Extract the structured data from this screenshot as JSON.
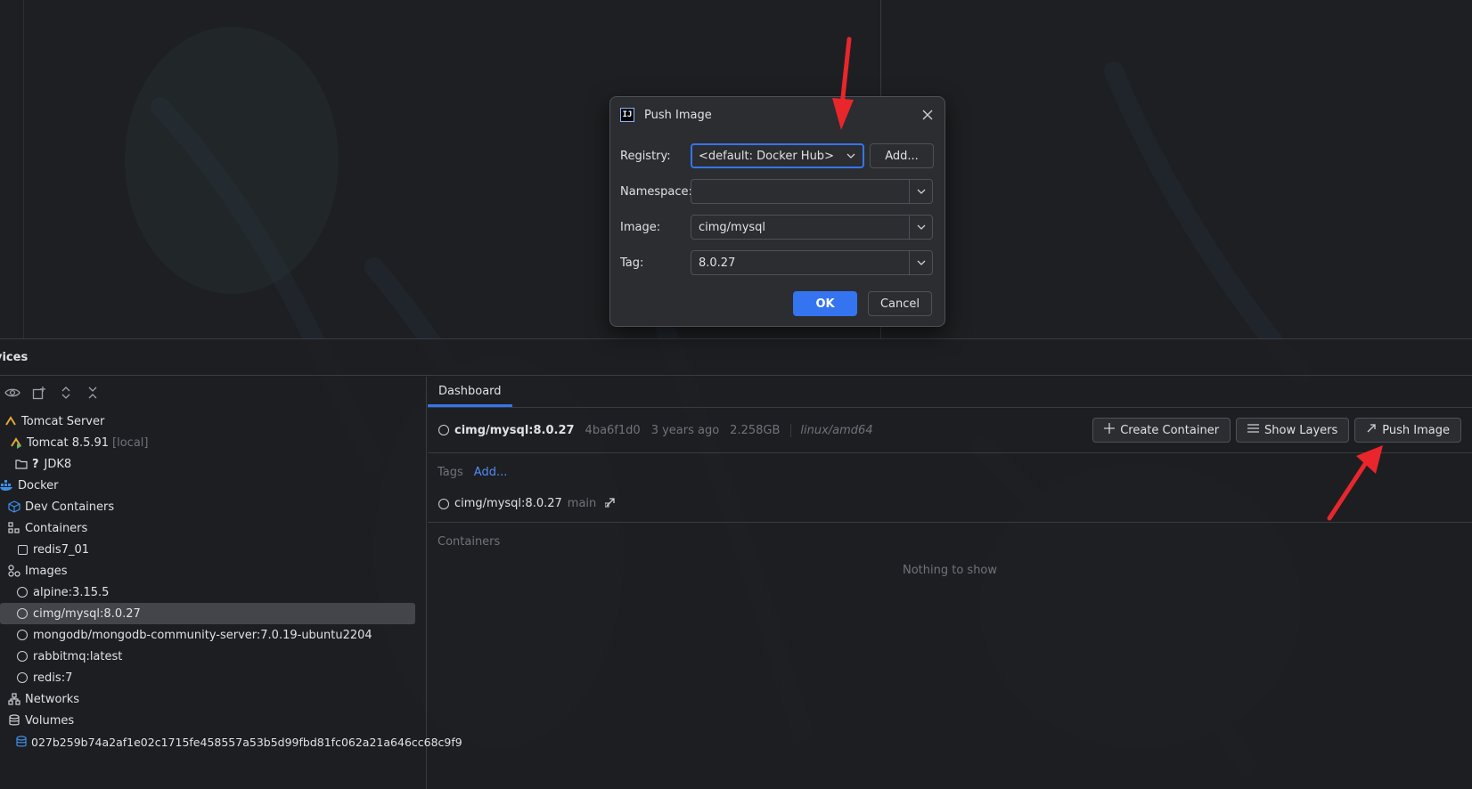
{
  "services": {
    "title": "vices",
    "tree": {
      "tomcat_server": "Tomcat Server",
      "tomcat_instance": "Tomcat 8.5.91",
      "tomcat_local": "[local]",
      "jdk": "JDK8",
      "jdk_prefix": "?",
      "docker": "Docker",
      "dev_containers": "Dev Containers",
      "containers": "Containers",
      "container_redis": "redis7_01",
      "images": "Images",
      "image_items": [
        "alpine:3.15.5",
        "cimg/mysql:8.0.27",
        "mongodb/mongodb-community-server:7.0.19-ubuntu2204",
        "rabbitmq:latest",
        "redis:7"
      ],
      "networks": "Networks",
      "volumes": "Volumes",
      "volume_item": "027b259b74a2af1e02c1715fe458557a53b5d99fbd81fc062a21a646cc68c9f9"
    },
    "dashboard": {
      "tab": "Dashboard",
      "image_name": "cimg/mysql:8.0.27",
      "image_id": "4ba6f1d0",
      "age": "3 years ago",
      "size": "2.258GB",
      "platform": "linux/amd64",
      "buttons": {
        "create_container": "Create Container",
        "show_layers": "Show Layers",
        "push_image": "Push Image"
      },
      "tags_label": "Tags",
      "tags_add": "Add...",
      "tag_item": "cimg/mysql:8.0.27",
      "tag_branch": "main",
      "containers_label": "Containers",
      "empty_text": "Nothing to show"
    }
  },
  "dialog": {
    "title": "Push Image",
    "registry_label": "Registry:",
    "registry_value": "<default: Docker Hub>",
    "add_button": "Add...",
    "namespace_label": "Namespace:",
    "namespace_value": "",
    "image_label": "Image:",
    "image_value": "cimg/mysql",
    "tag_label": "Tag:",
    "tag_value": "8.0.27",
    "ok": "OK",
    "cancel": "Cancel"
  },
  "colors": {
    "accent": "#3574f0",
    "link": "#548af7",
    "annotation_arrow": "#e8262c"
  }
}
